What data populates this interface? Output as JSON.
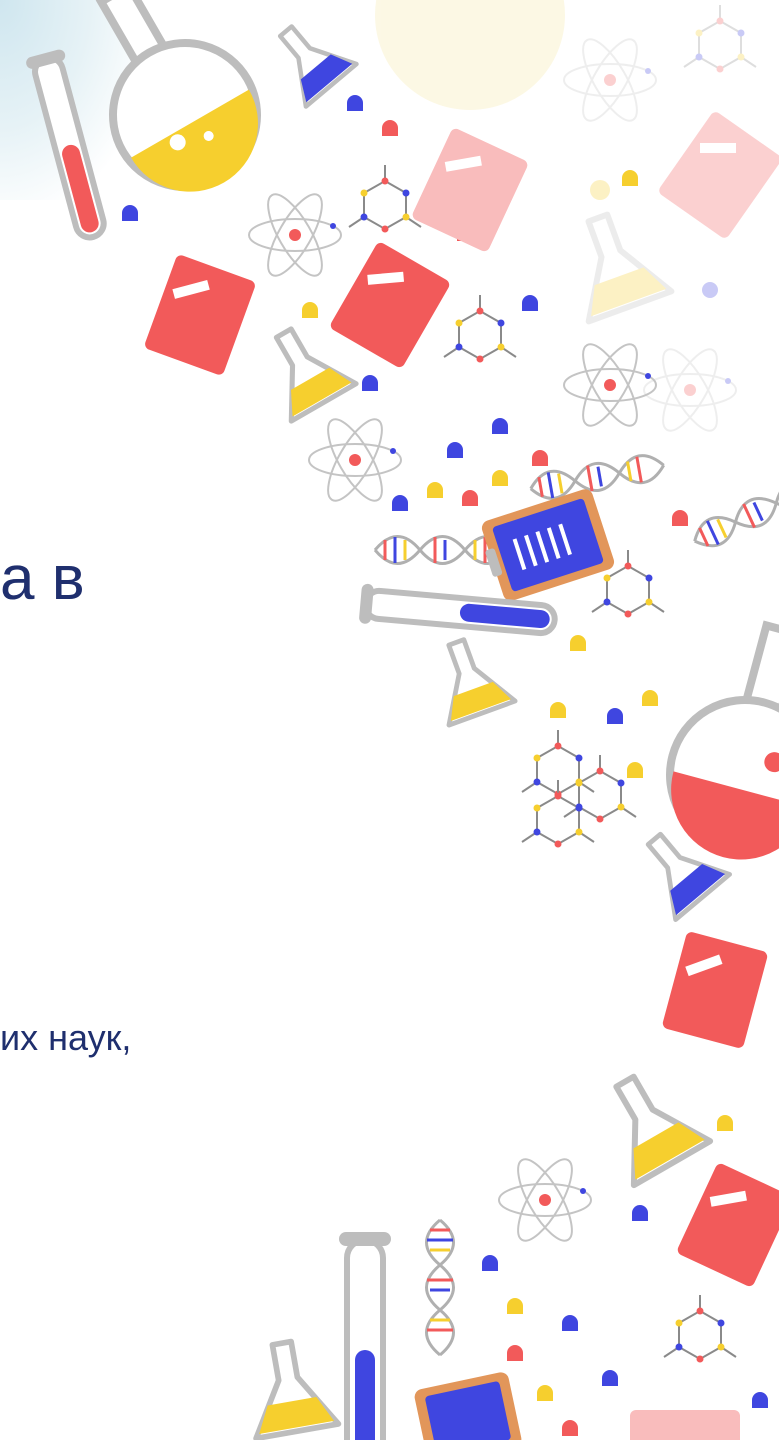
{
  "slide": {
    "heading_fragment": "а в",
    "body_fragment": "их наук,"
  },
  "palette": {
    "text": "#1f2f6e",
    "red": "#f25a5a",
    "blue": "#3f46e0",
    "yellow": "#f6cf2e",
    "glass": "#b8b8b8",
    "orange": "#e2965a"
  },
  "decorations": [
    "test-tube-icon",
    "round-flask-icon",
    "conical-flask-icon",
    "atom-icon",
    "molecule-icon",
    "notebook-icon",
    "clipboard-icon",
    "dna-icon",
    "pill-icon"
  ]
}
